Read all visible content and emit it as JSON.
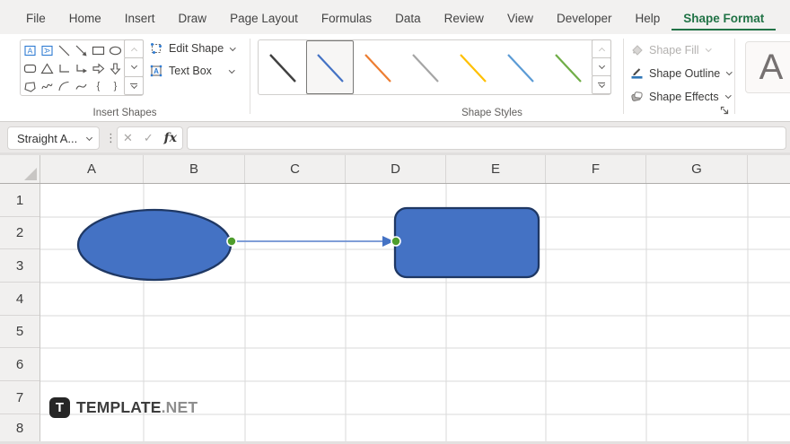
{
  "menubar": {
    "items": [
      {
        "label": "File"
      },
      {
        "label": "Home"
      },
      {
        "label": "Insert"
      },
      {
        "label": "Draw"
      },
      {
        "label": "Page Layout"
      },
      {
        "label": "Formulas"
      },
      {
        "label": "Data"
      },
      {
        "label": "Review"
      },
      {
        "label": "View"
      },
      {
        "label": "Developer"
      },
      {
        "label": "Help"
      },
      {
        "label": "Shape Format"
      }
    ],
    "active_tab": "Shape Format",
    "active_color": "#217346"
  },
  "ribbon": {
    "insert_shapes": {
      "label": "Insert Shapes",
      "edit_shape_label": "Edit Shape",
      "text_box_label": "Text Box",
      "gallery_icons": [
        "text-box-icon",
        "vertical-text-box-icon",
        "line-icon",
        "line-arrow-icon",
        "rectangle-icon",
        "oval-icon",
        "rounded-rectangle-icon",
        "triangle-icon",
        "elbow-connector-icon",
        "elbow-arrow-connector-icon",
        "block-arrow-right-icon",
        "block-arrow-down-icon",
        "freeform-icon",
        "scribble-icon",
        "arc-icon",
        "curve-icon",
        "left-brace-icon",
        "right-brace-icon"
      ],
      "brace_left": "{",
      "brace_right": "}"
    },
    "shape_styles": {
      "label": "Shape Styles",
      "selected_index": 1,
      "styles": [
        {
          "name": "black-line-style",
          "color": "#404040"
        },
        {
          "name": "blue-line-style",
          "color": "#4472C4"
        },
        {
          "name": "orange-line-style",
          "color": "#ED7D31"
        },
        {
          "name": "gray-line-style",
          "color": "#A5A5A5"
        },
        {
          "name": "gold-line-style",
          "color": "#FFC000"
        },
        {
          "name": "light-blue-line-style",
          "color": "#5B9BD5"
        },
        {
          "name": "green-line-style",
          "color": "#70AD47"
        }
      ]
    },
    "format_buttons": {
      "shape_fill_label": "Shape Fill",
      "shape_outline_label": "Shape Outline",
      "shape_effects_label": "Shape Effects"
    },
    "wordart": {
      "preview_letter": "A"
    }
  },
  "formula_bar": {
    "name_box_value": "Straight A...",
    "fx_label": "fx",
    "cancel_glyph": "✕",
    "enter_glyph": "✓",
    "dots_glyph": "⋮",
    "formula_value": ""
  },
  "sheet": {
    "columns": [
      "A",
      "B",
      "C",
      "D",
      "E",
      "F",
      "G"
    ],
    "rows": [
      "1",
      "2",
      "3",
      "4",
      "5",
      "6",
      "7",
      "8"
    ],
    "drawing": {
      "shape_fill": "#4472C4",
      "shape_stroke": "#1F3864",
      "connector_line_color": "#6E91D2",
      "connector_arrow_color": "#4472C4",
      "endpoint_color": "#4E9D2D"
    }
  },
  "watermark": {
    "badge_letter": "T",
    "name": "TEMPLATE",
    "tld": ".NET"
  }
}
